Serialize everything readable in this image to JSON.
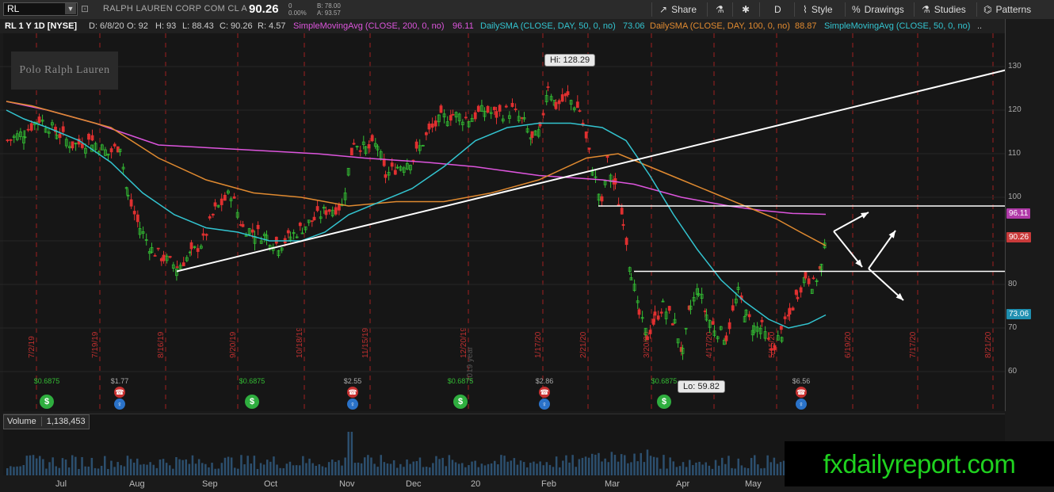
{
  "header": {
    "symbol": "RL",
    "company": "RALPH LAUREN CORP COM CL A",
    "last": "90.26",
    "change": "0",
    "change_pct": "0.00%",
    "bid": "B: 78.00",
    "ask": "A: 93.57",
    "buttons": {
      "share": "Share",
      "flask": "",
      "gear": "",
      "period": "D",
      "style": "Style",
      "drawings": "Drawings",
      "studies": "Studies",
      "patterns": "Patterns"
    }
  },
  "studybar": {
    "info": "RL 1 Y 1D [NYSE]",
    "date": "D: 6/8/20",
    "open": "O: 92",
    "high": "H: 93",
    "low": "L: 88.43",
    "close": "C: 90.26",
    "range": "R: 4.57",
    "study1": "SimpleMovingAvg (CLOSE, 200, 0, no)",
    "study1_val": "96.11",
    "study2": "DailySMA (CLOSE, DAY, 50, 0, no)",
    "study2_val": "73.06",
    "study3": "DailySMA (CLOSE, DAY, 100, 0, no)",
    "study3_val": "88.87",
    "study4": "SimpleMovingAvg (CLOSE, 50, 0, no)",
    "study4_val": ".."
  },
  "logo": "Polo Ralph Lauren",
  "callouts": {
    "high": "Hi: 128.29",
    "low": "Lo: 59.82"
  },
  "price_tags": {
    "sma200": "96.11",
    "last": "90.26",
    "sma50": "73.06"
  },
  "colors": {
    "up": "#33bb33",
    "down": "#e03030",
    "sma200": "#dd55dd",
    "sma100": "#e08a30",
    "sma50": "#33c4d0",
    "grid_red": "#a02020",
    "drawing": "#ffffff"
  },
  "price_axis": {
    "ticks": [
      "130",
      "120",
      "110",
      "100",
      "80",
      "70",
      "60"
    ]
  },
  "date_axis": {
    "labels": [
      "Jul",
      "Aug",
      "Sep",
      "Oct",
      "Nov",
      "Dec",
      "20",
      "Feb",
      "Mar",
      "Apr",
      "May"
    ]
  },
  "vertical_date_labels": [
    "7/2/19",
    "7/19/19",
    "8/16/19",
    "9/20/19",
    "10/18/19",
    "11/15/19",
    "12/20/19",
    "1/17/20",
    "2/21/20",
    "3/20/20",
    "4/17/20",
    "5/15/20",
    "6/19/20",
    "7/17/20",
    "8/21/20"
  ],
  "year_label": "2019 year",
  "events": [
    {
      "type": "div",
      "label": "$0.6875"
    },
    {
      "type": "earn",
      "label": "$1.77"
    },
    {
      "type": "div",
      "label": "$0.6875"
    },
    {
      "type": "earn",
      "label": "$2.55"
    },
    {
      "type": "div",
      "label": "$0.6875"
    },
    {
      "type": "earn",
      "label": "$2.86"
    },
    {
      "type": "div",
      "label": "$0.6875"
    },
    {
      "type": "earn",
      "label": "$6.56"
    }
  ],
  "volume": {
    "label": "Volume",
    "value": "1,138,453"
  },
  "watermark": "fxdailyreport.com",
  "levels": {
    "upper": 98,
    "lower": 83
  }
}
